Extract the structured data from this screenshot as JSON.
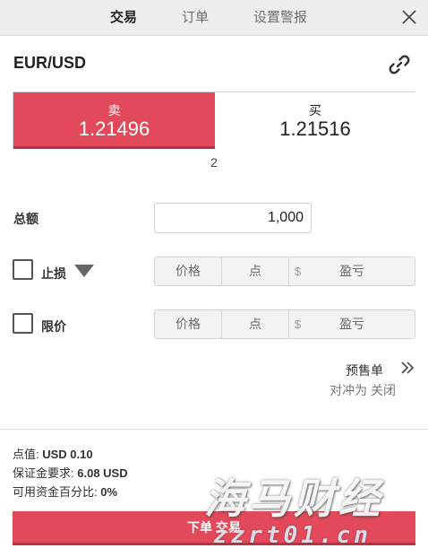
{
  "tabs": [
    {
      "label": "交易",
      "active": true
    },
    {
      "label": "订单",
      "active": false
    },
    {
      "label": "设置警报",
      "active": false
    }
  ],
  "instrument": {
    "symbol": "EUR/USD"
  },
  "quote": {
    "sell_label": "卖",
    "sell_price": "1.21496",
    "buy_label": "买",
    "buy_price": "1.21516",
    "spread": "2"
  },
  "amount": {
    "label": "总额",
    "value": "1,000"
  },
  "stop_loss": {
    "label": "止损",
    "checked": false,
    "price_placeholder": "价格",
    "points_placeholder": "点",
    "currency_symbol": "$",
    "pnl_placeholder": "盈亏"
  },
  "limit": {
    "label": "限价",
    "checked": false,
    "price_placeholder": "价格",
    "points_placeholder": "点",
    "currency_symbol": "$",
    "pnl_placeholder": "盈亏"
  },
  "pre_order": {
    "label": "预售单",
    "hedge_text": "对冲为 关闭"
  },
  "info": {
    "pip_value_label": "点值:",
    "pip_value": "USD 0.10",
    "margin_label": "保证金要求:",
    "margin": "6.08 USD",
    "available_pct_label": "可用资金百分比:",
    "available_pct": "0%"
  },
  "order_button": {
    "label": "下单 交易"
  },
  "watermark": {
    "main": "海马财经",
    "sub": "zzrt01.cn"
  },
  "colors": {
    "accent_red": "#e24a5b",
    "tab_bg": "#eeeeee"
  }
}
